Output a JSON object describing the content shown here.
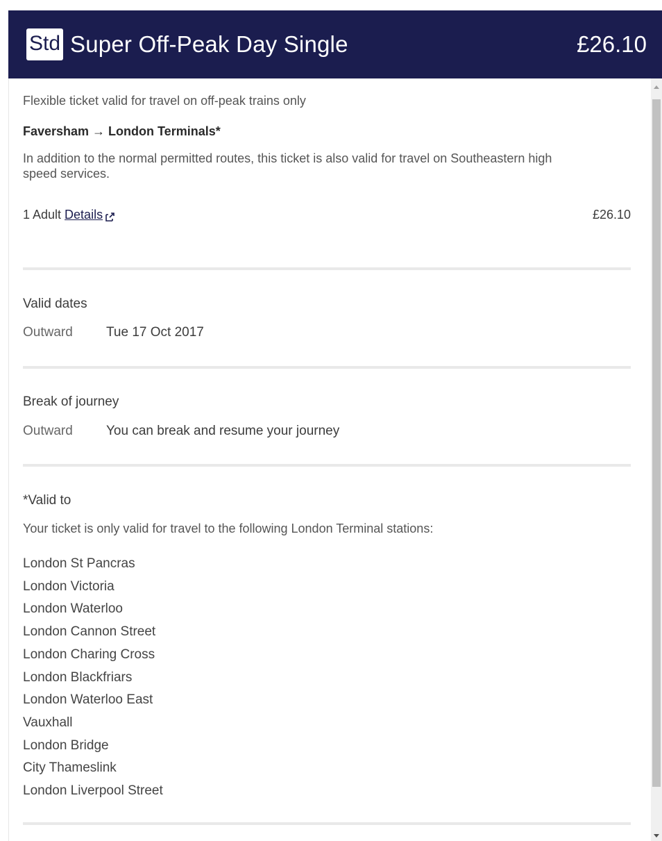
{
  "header": {
    "class_badge": "Std",
    "title": "Super Off-Peak Day Single",
    "price": "£26.10"
  },
  "ticket": {
    "subtitle": "Flexible ticket valid for travel on off-peak trains only",
    "route": "Faversham → London Terminals*",
    "note": "In addition to the normal permitted routes, this ticket is also valid for travel on Southeastern high speed services.",
    "passengers": "1 Adult",
    "details_link": "Details",
    "passenger_price": "£26.10"
  },
  "valid_dates": {
    "title": "Valid dates",
    "label": "Outward",
    "value": "Tue 17 Oct 2017"
  },
  "break_of_journey": {
    "title": "Break of journey",
    "label": "Outward",
    "value": "You can break and resume your journey"
  },
  "valid_to": {
    "title": "*Valid to",
    "description": "Your ticket is only valid for travel to the following London Terminal stations:",
    "stations": [
      "London St Pancras",
      "London Victoria",
      "London Waterloo",
      "London Cannon Street",
      "London Charing Cross",
      "London Blackfriars",
      "London Waterloo East",
      "Vauxhall",
      "London Bridge",
      "City Thameslink",
      "London Liverpool Street"
    ]
  },
  "icons": {
    "details_link_icon": "external-link-icon"
  }
}
